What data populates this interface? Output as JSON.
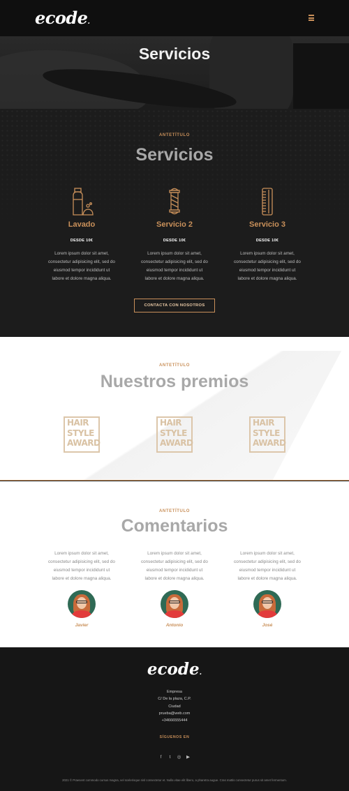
{
  "header": {
    "logo": "ecode",
    "logo_dot": ".",
    "menu_icon": "hamburger-icon"
  },
  "hero": {
    "title": "Servicios"
  },
  "services": {
    "eyebrow": "ANTETÍTULO",
    "title": "Servicios",
    "items": [
      {
        "name": "Lavado",
        "price": "DESDE 10€",
        "icon": "shampoo-bottle-icon",
        "lines": [
          "Lorem ipsum dolor sit amet,",
          "consectetur adipisicing elit, sed do",
          "eiusmod tempor incididunt ut",
          "labore et dolore magna aliqua."
        ]
      },
      {
        "name": "Servicio 2",
        "price": "DESDE 10€",
        "icon": "barber-pole-icon",
        "lines": [
          "Lorem ipsum dolor sit amet,",
          "consectetur adipisicing elit, sed do",
          "eiusmod tempor incididunt ut",
          "labore et dolore magna aliqua."
        ]
      },
      {
        "name": "Servicio 3",
        "price": "DESDE 10€",
        "icon": "comb-icon",
        "lines": [
          "Lorem ipsum dolor sit amet,",
          "consectetur adipisicing elit, sed do",
          "eiusmod tempor incididunt ut",
          "labore et dolore magna aliqua."
        ]
      }
    ],
    "cta": "CONTACTA CON NOSOTROS"
  },
  "awards": {
    "eyebrow": "ANTETÍTULO",
    "title": "Nuestros premios",
    "badge_lines": [
      "HAIR",
      "STYLE",
      "AWARD"
    ]
  },
  "comments": {
    "eyebrow": "ANTETÍTULO",
    "title": "Comentarios",
    "items": [
      {
        "name": "Javier",
        "lines": [
          "Lorem ipsum dolor sit amet,",
          "consectetur adipisicing elit, sed do",
          "eiusmod tempor incididunt ut",
          "labore et dolore magna aliqua."
        ]
      },
      {
        "name": "Antonio",
        "lines": [
          "Lorem ipsum dolor sit amet,",
          "consectetur adipisicing elit, sed do",
          "eiusmod tempor incididunt ut",
          "labore et dolore magna aliqua."
        ]
      },
      {
        "name": "José",
        "lines": [
          "Lorem ipsum dolor sit amet,",
          "consectetur adipisicing elit, sed do",
          "eiusmod tempor incididunt ut",
          "labore et dolore magna aliqua."
        ]
      }
    ]
  },
  "footer": {
    "logo": "ecode",
    "company": "Empresa",
    "address": "C/ De la plaza, C.P.",
    "city": "Ciudad",
    "email": "prueba@web.com",
    "phone": "+34666555444",
    "follow": "SÍGUENOS EN",
    "social_icons": [
      "facebook-icon",
      "twitter-icon",
      "instagram-icon",
      "youtube-icon"
    ],
    "social_glyphs": [
      "f",
      "t",
      "◎",
      "▶"
    ],
    "copyright": "2021 © Praesent commodo cursus magna, vel scelerisque nisl consectetur et. Nulla vitae elit libero, a pharetra augue. Cras mattis consectetur purus sit amet fermentum."
  },
  "colors": {
    "accent": "#c9905a",
    "dark": "#1b1b1b",
    "award": "#dcc6aa"
  }
}
